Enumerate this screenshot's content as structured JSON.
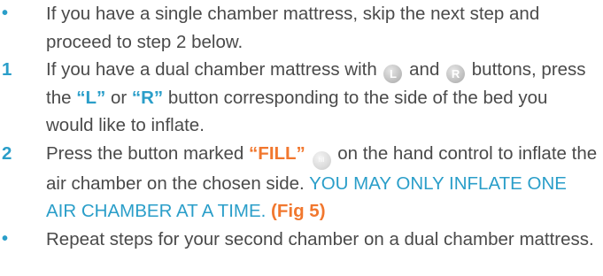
{
  "steps": [
    {
      "marker": "•",
      "text": "If you have a single chamber mattress, skip the next step and proceed to  step 2 below."
    },
    {
      "marker": "1",
      "part1": "If you have a dual chamber mattress with",
      "icon_l": "L",
      "part2": "and",
      "icon_r": "R",
      "part3": "buttons, press the",
      "l_label": "“L”",
      "part4": "or",
      "r_label": "“R”",
      "part5": "button corresponding to the side of the bed you would like to inflate."
    },
    {
      "marker": "2",
      "part1": "Press the button marked",
      "fill_label": "“FILL”",
      "icon_fill": "fill",
      "part2": "on the hand control to inflate the air chamber on the chosen side.",
      "warning": "YOU MAY ONLY INFLATE ONE AIR CHAMBER AT A TIME.",
      "fig_ref": "(Fig 5)"
    },
    {
      "marker": "•",
      "text": "Repeat steps for your second chamber on a dual chamber mattress."
    }
  ],
  "colors": {
    "accent_blue": "#2a9ec9",
    "accent_orange": "#f1772e",
    "body_text": "#4a4a4a",
    "button_gray": "#c4c4c4"
  }
}
